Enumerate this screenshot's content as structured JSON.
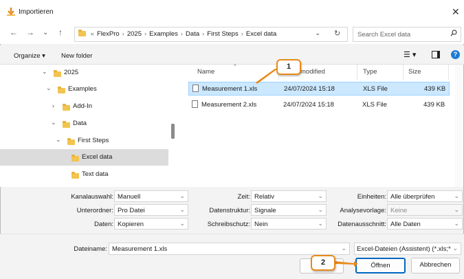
{
  "window": {
    "title": "Importieren"
  },
  "address": {
    "crumbs": [
      "FlexPro",
      "2025",
      "Examples",
      "Data",
      "First Steps",
      "Excel data"
    ],
    "overflow_label": "«"
  },
  "search": {
    "placeholder": "Search Excel data"
  },
  "toolbar": {
    "organize_label": "Organize ▾",
    "new_folder_label": "New folder"
  },
  "tree": [
    {
      "label": "2025",
      "chevron": "⌄",
      "selected": false
    },
    {
      "label": "Examples",
      "chevron": "⌄",
      "selected": false
    },
    {
      "label": "Add-In",
      "chevron": "›",
      "selected": false
    },
    {
      "label": "Data",
      "chevron": "⌄",
      "selected": false
    },
    {
      "label": "First Steps",
      "chevron": "⌄",
      "selected": false
    },
    {
      "label": "Excel data",
      "chevron": "",
      "selected": true
    },
    {
      "label": "Text data",
      "chevron": "",
      "selected": false
    }
  ],
  "columns": {
    "name": "Name",
    "modified": "modified",
    "type": "Type",
    "size": "Size"
  },
  "files": [
    {
      "name": "Measurement 1.xls",
      "modified": "24/07/2024 15:18",
      "type": "XLS File",
      "size": "439 KB",
      "selected": true
    },
    {
      "name": "Measurement 2.xls",
      "modified": "24/07/2024 15:18",
      "type": "XLS File",
      "size": "439 KB",
      "selected": false
    }
  ],
  "options": {
    "kanalauswahl": {
      "label": "Kanalauswahl:",
      "value": "Manuell"
    },
    "unterordner": {
      "label": "Unterordner:",
      "value": "Pro Datei"
    },
    "daten": {
      "label": "Daten:",
      "value": "Kopieren"
    },
    "zeit": {
      "label": "Zeit:",
      "value": "Relativ"
    },
    "datenstruktur": {
      "label": "Datenstruktur:",
      "value": "Signale"
    },
    "schreibschutz": {
      "label": "Schreibschutz:",
      "value": "Nein"
    },
    "einheiten": {
      "label": "Einheiten:",
      "value": "Alle überprüfen"
    },
    "analysevorlage": {
      "label": "Analysevorlage:",
      "value": "Keine"
    },
    "datenausschnitt": {
      "label": "Datenausschnitt:",
      "value": "Alle Daten"
    }
  },
  "filename": {
    "label": "Dateiname:",
    "value": "Measurement 1.xls"
  },
  "filetype": {
    "value": "Excel-Dateien (Assistent) (*.xls;*"
  },
  "buttons": {
    "open": "Öffnen",
    "cancel": "Abbrechen"
  },
  "callouts": {
    "one": "1",
    "two": "2"
  },
  "colors": {
    "accent": "#0067c0",
    "callout_border": "#e88a1a",
    "selection": "#cce8ff",
    "folder": "#f2c450"
  }
}
